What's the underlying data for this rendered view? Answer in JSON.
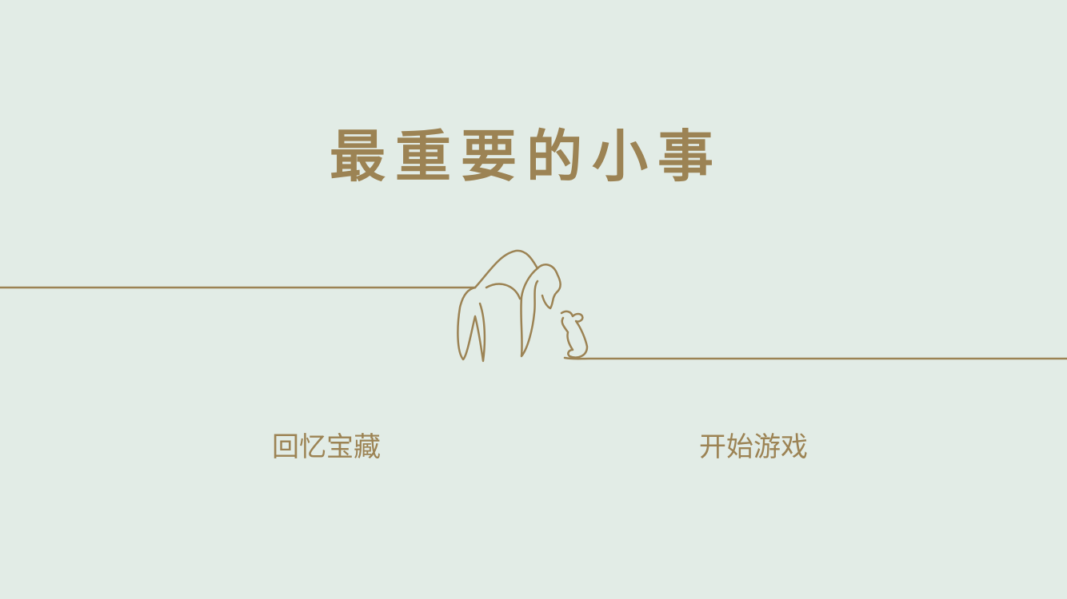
{
  "title": "最重要的小事",
  "menu": {
    "memories_label": "回忆宝藏",
    "start_label": "开始游戏"
  },
  "colors": {
    "background": "#e2ece6",
    "accent": "#9c8354"
  },
  "illustration": {
    "icon": "gorilla-and-mouse-line-art"
  }
}
